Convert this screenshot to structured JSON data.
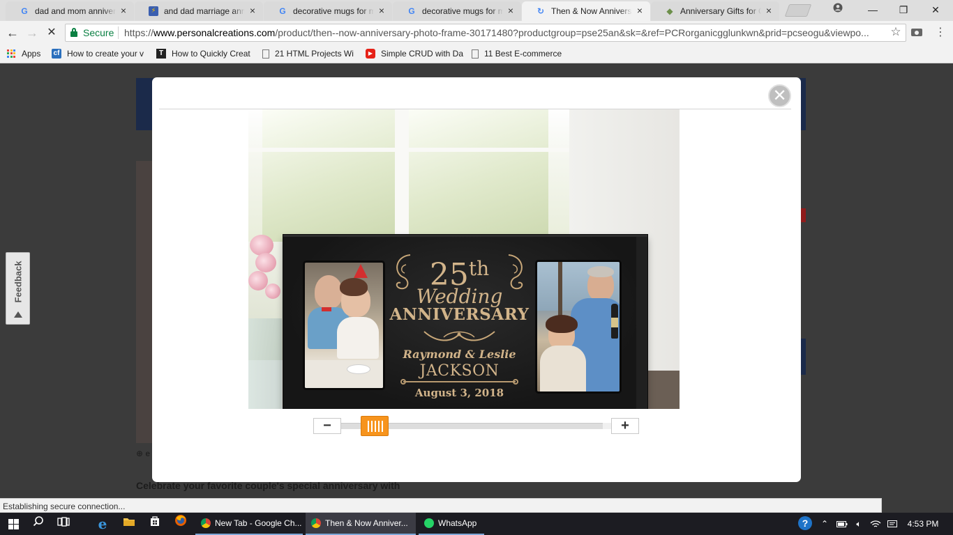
{
  "window_controls": {
    "minimize": "—",
    "maximize": "❐",
    "close": "✕"
  },
  "tabs": [
    {
      "title": "dad and mom anniversary",
      "favicon": "G",
      "favicon_color": "#4285f4",
      "active": false
    },
    {
      "title": "and dad marriage anniv",
      "favicon": "⚡",
      "favicon_color": "#f4c400",
      "active": false
    },
    {
      "title": "decorative mugs for mom",
      "favicon": "G",
      "favicon_color": "#4285f4",
      "active": false
    },
    {
      "title": "decorative mugs for mom",
      "favicon": "G",
      "favicon_color": "#4285f4",
      "active": false
    },
    {
      "title": "Then & Now Anniversary",
      "favicon": "↻",
      "favicon_color": "#4285f4",
      "active": true
    },
    {
      "title": "Anniversary Gifts for Co",
      "favicon": "◆",
      "favicon_color": "#6c8f4a",
      "active": false
    }
  ],
  "omnibox": {
    "secure_label": "Secure",
    "scheme": "https://",
    "host": "www.personalcreations.com",
    "path": "/product/then--now-anniversary-photo-frame-30171480?productgroup=pse25an&sk=&ref=PCRorganicgglunkwn&prid=pcseogu&viewpo..."
  },
  "bookmarks": [
    {
      "label": "Apps",
      "icon": "apps-grid"
    },
    {
      "label": "How to create your v",
      "icon": "cf",
      "icon_color": "#2a6fbd"
    },
    {
      "label": "How to Quickly Creat",
      "icon": "T",
      "icon_color": "#222"
    },
    {
      "label": "21 HTML Projects Wi",
      "icon": "doc",
      "icon_color": "#666"
    },
    {
      "label": "Simple CRUD with Da",
      "icon": "▶",
      "icon_color": "#e62117"
    },
    {
      "label": "11 Best E-commerce",
      "icon": "doc",
      "icon_color": "#666"
    }
  ],
  "feedback": {
    "label": "Feedback"
  },
  "modal": {
    "close_label": "✕",
    "frame": {
      "number": "25",
      "number_suffix": "th",
      "line2": "Wedding",
      "line3": "ANNIVERSARY",
      "names": "Raymond & Leslie",
      "surname": "JACKSON",
      "date": "August 3, 2018"
    },
    "zoom": {
      "minus": "−",
      "plus": "+",
      "level": 0.08
    }
  },
  "background_page": {
    "enlarge_label": "e",
    "description": "Celebrate your favorite couple's special anniversary with"
  },
  "status_text": "Establishing secure connection...",
  "taskbar": {
    "tasks": [
      {
        "label": "New Tab - Google Ch...",
        "icon_color": "#db4437",
        "state": "running"
      },
      {
        "label": "Then & Now Anniver...",
        "icon_color": "#db4437",
        "state": "active"
      },
      {
        "label": "WhatsApp",
        "icon_color": "#25d366",
        "state": "running"
      }
    ],
    "clock": "4:53 PM"
  },
  "colors": {
    "accent_orange": "#f7941d",
    "secure_green": "#0b8043",
    "engraving_gold": "#d2b48a"
  }
}
